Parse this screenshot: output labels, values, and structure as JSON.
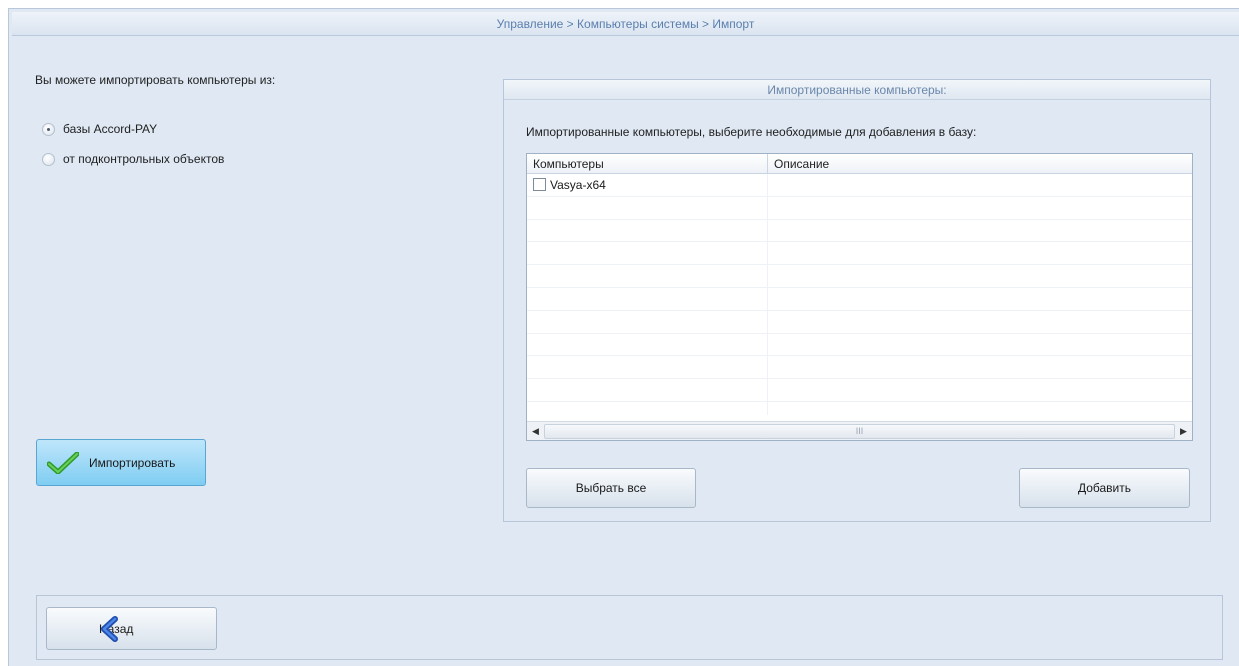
{
  "breadcrumb": "Управление > Компьютеры системы > Импорт",
  "import_source": {
    "label": "Вы можете импортировать компьютеры из:",
    "options": [
      {
        "label": "базы Accord-PAY",
        "selected": true
      },
      {
        "label": "от подконтрольных объектов",
        "selected": false
      }
    ]
  },
  "import_button": {
    "label": "Импортировать",
    "icon": "checkmark-icon",
    "color": "#7fcdf2"
  },
  "imported_panel": {
    "title": "Импортированные компьютеры:",
    "description": "Импортированные компьютеры, выберите необходимые для добавления в базу:",
    "columns": [
      "Компьютеры",
      "Описание"
    ],
    "rows": [
      {
        "name": "Vasya-x64",
        "description": "",
        "checked": false
      }
    ],
    "scroll_grip": "III",
    "select_all_label": "Выбрать все",
    "add_label": "Добавить"
  },
  "footer": {
    "back_label": "Назад",
    "back_icon": "chevron-left-icon"
  },
  "colors": {
    "accent_text": "#5a7fae",
    "background": "#dfe8f3",
    "import_button": "#7fcdf2"
  }
}
